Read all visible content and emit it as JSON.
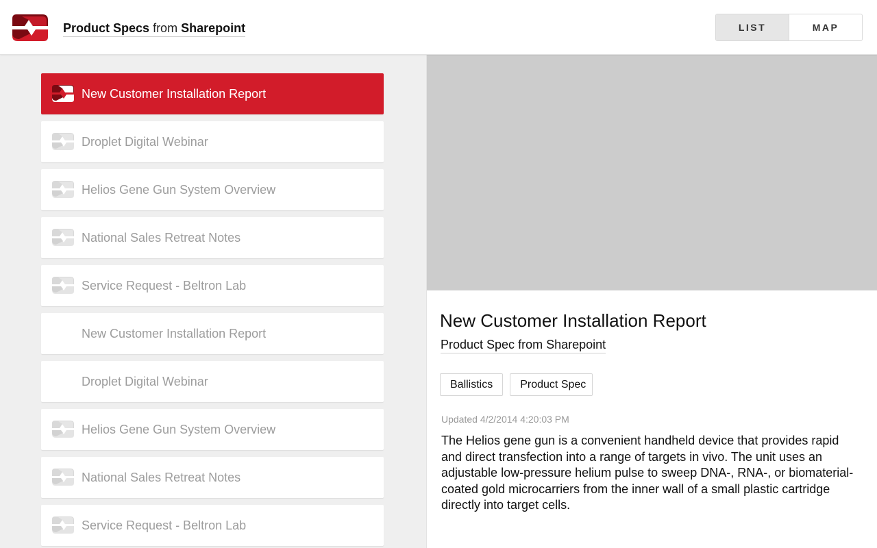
{
  "header": {
    "title_part1": "Product Specs",
    "title_part2": "from",
    "title_part3": "Sharepoint",
    "toggle": [
      {
        "label": "LIST",
        "active": true
      },
      {
        "label": "MAP",
        "active": false
      }
    ]
  },
  "colors": {
    "brand_red": "#d21c2a",
    "brand_dark_red": "#7a0a12"
  },
  "list": {
    "items": [
      {
        "label": "New Customer Installation Report",
        "selected": true,
        "has_icon": true
      },
      {
        "label": "Droplet Digital Webinar",
        "selected": false,
        "has_icon": true
      },
      {
        "label": "Helios Gene Gun System Overview",
        "selected": false,
        "has_icon": true
      },
      {
        "label": "National Sales Retreat Notes",
        "selected": false,
        "has_icon": true
      },
      {
        "label": "Service Request - Beltron Lab",
        "selected": false,
        "has_icon": true
      },
      {
        "label": "New Customer Installation Report",
        "selected": false,
        "has_icon": false
      },
      {
        "label": "Droplet Digital Webinar",
        "selected": false,
        "has_icon": false
      },
      {
        "label": "Helios Gene Gun System Overview",
        "selected": false,
        "has_icon": true
      },
      {
        "label": "National Sales Retreat Notes",
        "selected": false,
        "has_icon": true
      },
      {
        "label": "Service Request - Beltron Lab",
        "selected": false,
        "has_icon": true
      }
    ]
  },
  "detail": {
    "title": "New Customer Installation Report",
    "source_part1": "Product Spec",
    "source_part2": "from",
    "source_part3": "Sharepoint",
    "tags": [
      "Ballistics",
      "Product Spec"
    ],
    "updated": "Updated 4/2/2014 4:20:03 PM",
    "description": "The Helios gene gun is a convenient handheld device that provides rapid and direct transfection into a range of targets in vivo. The unit uses an adjustable low-pressure helium pulse to sweep DNA-, RNA-, or biomaterial-coated gold microcarriers from the inner wall of a small plastic cartridge directly into target cells."
  }
}
